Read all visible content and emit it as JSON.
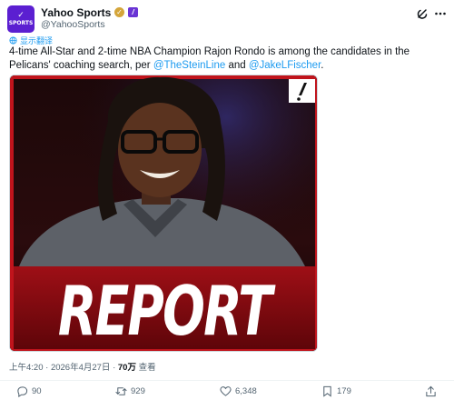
{
  "post": {
    "author": {
      "display_name": "Yahoo Sports",
      "handle": "@YahooSports",
      "avatar_text": "SPORTS",
      "avatar_color": "#5b1fd1"
    },
    "translate_label": "显示翻译",
    "text_before": "4-time All-Star and 2-time NBA Champion Rajon Rondo is among the candidates in the Pelicans' coaching search, per ",
    "mention_1": "@TheSteinLine",
    "text_between": " and ",
    "mention_2": "@JakeLFischer",
    "text_after": ".",
    "media": {
      "overlay_text": "REPORT",
      "badge_icon": "exclamation-icon"
    },
    "meta": {
      "time": "上午4:20",
      "separator": " · ",
      "date": "2026年4月27日",
      "views_count": "70万",
      "views_label": "查看"
    },
    "actions": {
      "replies": "90",
      "reposts": "929",
      "likes": "6,348",
      "bookmarks": "179"
    }
  },
  "colors": {
    "link": "#1d9bf0",
    "muted": "#536471",
    "media_red": "#c0141c"
  }
}
